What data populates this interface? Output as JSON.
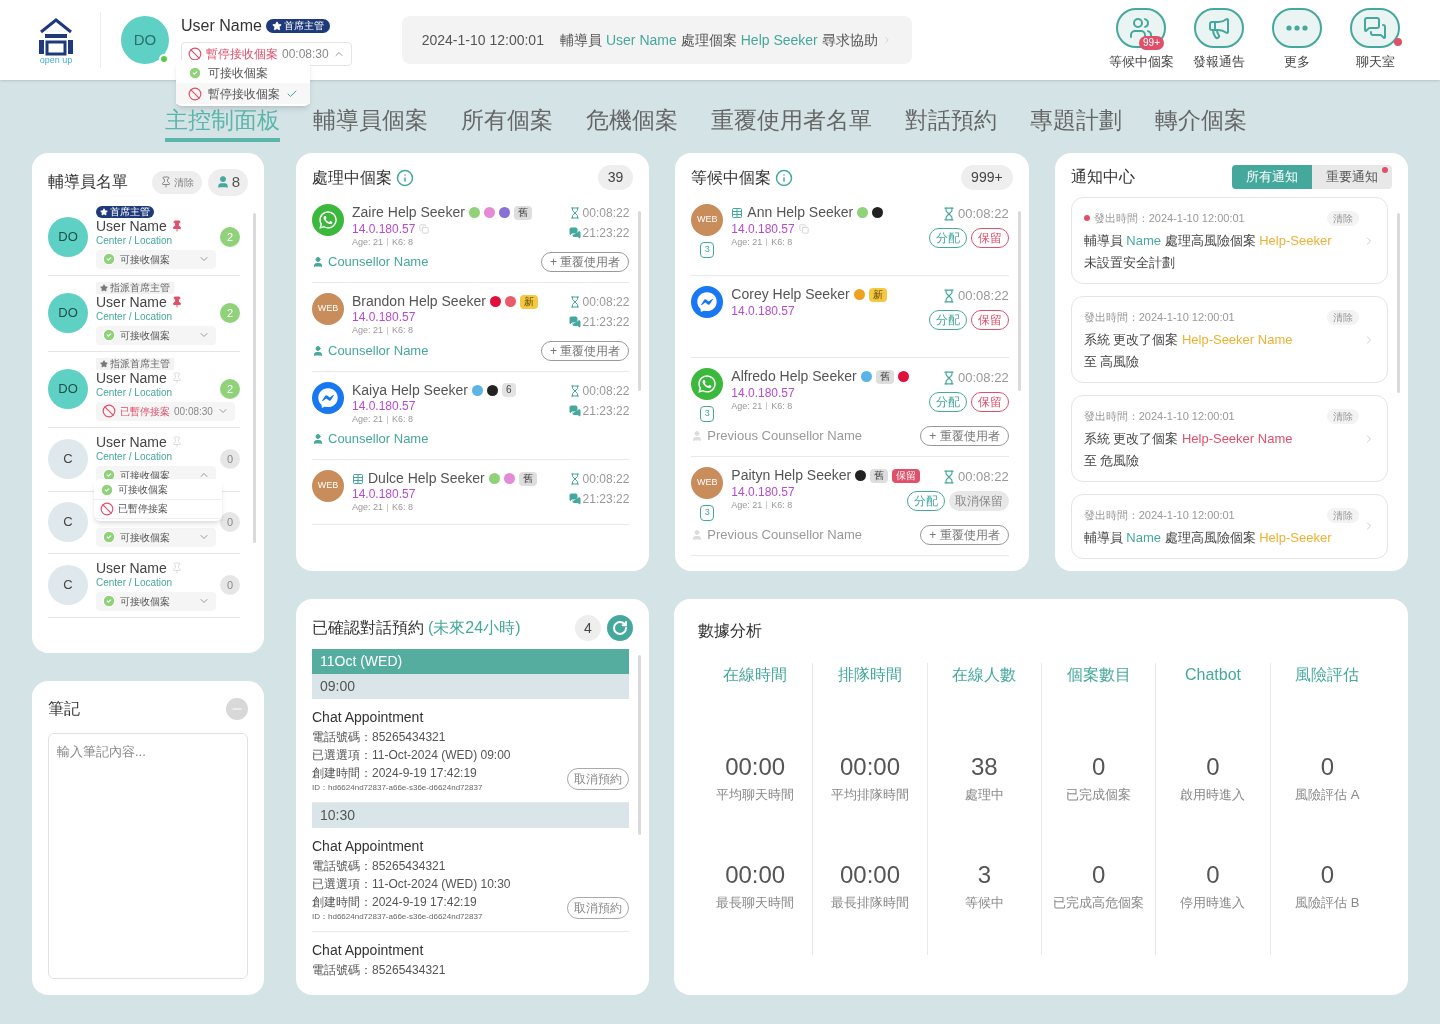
{
  "header": {
    "logo_text": "open up",
    "user": {
      "initials": "DO",
      "online": true,
      "name": "User Name",
      "role": "首席主管",
      "status": {
        "kind": "paused",
        "label": "暫停接收個案",
        "timer": "00:08:30",
        "expanded": true,
        "options": [
          {
            "kind": "available",
            "label": "可接收個案",
            "selected": false
          },
          {
            "kind": "paused",
            "label": "暫停接收個案",
            "selected": true
          }
        ]
      }
    },
    "ticker": {
      "time": "2024-1-10 12:00:01",
      "parts": [
        {
          "kind": "text",
          "text": "輔導員"
        },
        {
          "kind": "link",
          "text": "User Name"
        },
        {
          "kind": "text",
          "text": "處理個案"
        },
        {
          "kind": "link",
          "text": "Help Seeker"
        },
        {
          "kind": "text",
          "text": "尋求協助"
        }
      ]
    },
    "actions": [
      {
        "kind": "waiting",
        "label": "等候中個案",
        "badge": "99+",
        "alert": false
      },
      {
        "kind": "broadcast",
        "label": "發報通告",
        "alert": false
      },
      {
        "kind": "more",
        "label": "更多",
        "alert": false
      },
      {
        "kind": "chat",
        "label": "聊天室",
        "alert": true
      }
    ]
  },
  "tabs": [
    {
      "label": "主控制面板",
      "selected": true
    },
    {
      "label": "輔導員個案",
      "selected": false
    },
    {
      "label": "所有個案",
      "selected": false
    },
    {
      "label": "危機個案",
      "selected": false
    },
    {
      "label": "重覆使用者名單",
      "selected": false
    },
    {
      "label": "對話預約",
      "selected": false
    },
    {
      "label": "專題計劃",
      "selected": false
    },
    {
      "label": "轉介個案",
      "selected": false
    }
  ],
  "counsellors": {
    "title": "輔導員名單",
    "clear": "清除",
    "count": "8",
    "items": [
      {
        "role": {
          "kind": "chief",
          "label": "首席主管"
        },
        "initials": "DO",
        "active": true,
        "name": "User Name",
        "pinned": true,
        "location": "Center / Location",
        "status": {
          "kind": "available",
          "label": "可接收個案",
          "expanded": false
        },
        "cases": "2"
      },
      {
        "role": {
          "kind": "assign",
          "label": "指派首席主管"
        },
        "initials": "DO",
        "active": true,
        "name": "User Name",
        "pinned": true,
        "location": "Center / Location",
        "status": {
          "kind": "available",
          "label": "可接收個案",
          "expanded": false
        },
        "cases": "2"
      },
      {
        "role": {
          "kind": "assign",
          "label": "指派首席主管"
        },
        "initials": "DO",
        "active": true,
        "name": "User Name",
        "pinned": false,
        "location": "Center / Location",
        "status": {
          "kind": "paused",
          "label": "已暫停接案",
          "timer": "00:08:30",
          "expanded": false
        },
        "cases": "2"
      },
      {
        "initials": "C",
        "active": false,
        "name": "User Name",
        "pinned": false,
        "location": "Center / Location",
        "status": {
          "kind": "available",
          "label": "可接收個案",
          "expanded": true,
          "options": [
            {
              "kind": "available",
              "label": "可接收個案"
            },
            {
              "kind": "paused",
              "label": "已暫停接案"
            }
          ]
        },
        "cases": "0"
      },
      {
        "initials": "C",
        "active": false,
        "status": {
          "kind": "available",
          "label": "可接收個案",
          "expanded": false
        },
        "cases": "0"
      },
      {
        "initials": "C",
        "active": false,
        "name": "User Name",
        "pinned": false,
        "location": "Center / Location",
        "status": {
          "kind": "available",
          "label": "可接收個案",
          "expanded": false
        },
        "cases": "0"
      }
    ]
  },
  "notes": {
    "title": "筆記",
    "placeholder": "輸入筆記內容..."
  },
  "processing": {
    "title": "處理中個案",
    "count": "39",
    "items": [
      {
        "channel": {
          "kind": "whatsapp"
        },
        "form": false,
        "name": "Zaire Help Seeker",
        "tags": [
          {
            "kind": "dot",
            "color": "#8fd27a"
          },
          {
            "kind": "dot",
            "color": "#e58ad6"
          },
          {
            "kind": "dot",
            "color": "#8b6fd6"
          },
          {
            "kind": "old",
            "text": "舊"
          }
        ],
        "ip": "14.0.180.57",
        "copyable": true,
        "age": "Age: 21",
        "k6": "K6: 8",
        "wait": "00:08:22",
        "chat": "21:23:22",
        "counsellor": "Counsellor Name",
        "repeat": "+ 重覆使用者"
      },
      {
        "channel": {
          "kind": "web",
          "label": "WEB"
        },
        "form": false,
        "name": "Brandon Help Seeker",
        "tags": [
          {
            "kind": "dot",
            "color": "#e0103a"
          },
          {
            "kind": "dot",
            "color": "#ea5a6a"
          },
          {
            "kind": "new",
            "text": "新"
          }
        ],
        "ip": "14.0.180.57",
        "copyable": false,
        "age": "Age: 21",
        "k6": "K6: 8",
        "wait": "00:08:22",
        "chat": "21:23:22",
        "counsellor": "Counsellor Name",
        "repeat": "+ 重覆使用者"
      },
      {
        "channel": {
          "kind": "messenger"
        },
        "form": false,
        "name": "Kaiya Help Seeker",
        "tags": [
          {
            "kind": "dot",
            "color": "#5ab4e6"
          },
          {
            "kind": "dot",
            "color": "#222222"
          },
          {
            "kind": "count",
            "text": "6"
          }
        ],
        "ip": "14.0.180.57",
        "copyable": false,
        "age": "Age: 21",
        "k6": "K6: 8",
        "wait": "00:08:22",
        "chat": "21:23:22",
        "counsellor": "Counsellor Name"
      },
      {
        "channel": {
          "kind": "web",
          "label": "WEB"
        },
        "form": true,
        "name": "Dulce Help Seeker",
        "tags": [
          {
            "kind": "dot",
            "color": "#8fd27a"
          },
          {
            "kind": "dot",
            "color": "#e58ad6"
          },
          {
            "kind": "old",
            "text": "舊"
          }
        ],
        "ip": "14.0.180.57",
        "copyable": false,
        "age": "Age: 21",
        "k6": "K6: 8",
        "wait": "00:08:22",
        "chat": "21:23:22"
      }
    ]
  },
  "waiting": {
    "title": "等候中個案",
    "count": "999+",
    "items": [
      {
        "channel": {
          "kind": "web",
          "label": "WEB"
        },
        "calendar_day": "3",
        "form": true,
        "name": "Ann Help Seeker",
        "tags": [
          {
            "kind": "dot",
            "color": "#8fd27a"
          },
          {
            "kind": "dot",
            "color": "#222222"
          }
        ],
        "ip": "14.0.180.57",
        "copyable": true,
        "age": "Age: 21",
        "k6": "K6: 8",
        "wait": "00:08:22",
        "actions": [
          {
            "kind": "assign",
            "label": "分配"
          },
          {
            "kind": "hold",
            "label": "保留"
          }
        ]
      },
      {
        "channel": {
          "kind": "messenger"
        },
        "form": false,
        "name": "Corey Help Seeker",
        "tags": [
          {
            "kind": "dot",
            "color": "#f0a020"
          },
          {
            "kind": "new",
            "text": "新"
          }
        ],
        "ip": "14.0.180.57",
        "copyable": false,
        "wait": "00:08:22",
        "actions": [
          {
            "kind": "assign",
            "label": "分配"
          },
          {
            "kind": "hold",
            "label": "保留"
          }
        ]
      },
      {
        "channel": {
          "kind": "whatsapp"
        },
        "calendar_day": "3",
        "form": false,
        "name": "Alfredo Help Seeker",
        "tags": [
          {
            "kind": "dot",
            "color": "#5ab4e6"
          },
          {
            "kind": "old",
            "text": "舊"
          },
          {
            "kind": "dot",
            "color": "#e0103a"
          }
        ],
        "ip": "14.0.180.57",
        "copyable": false,
        "age": "Age: 21",
        "k6": "K6: 8",
        "wait": "00:08:22",
        "actions": [
          {
            "kind": "assign",
            "label": "分配"
          },
          {
            "kind": "hold",
            "label": "保留"
          }
        ],
        "previous": "Previous Counsellor Name",
        "repeat": "+ 重覆使用者"
      },
      {
        "channel": {
          "kind": "web",
          "label": "WEB"
        },
        "calendar_day": "3",
        "form": false,
        "name": "Paityn Help Seeker",
        "tags": [
          {
            "kind": "dot",
            "color": "#222222"
          },
          {
            "kind": "old",
            "text": "舊"
          },
          {
            "kind": "hold",
            "text": "保留"
          }
        ],
        "ip": "14.0.180.57",
        "copyable": false,
        "age": "Age: 21",
        "k6": "K6: 8",
        "wait": "00:08:22",
        "actions": [
          {
            "kind": "assign",
            "label": "分配"
          },
          {
            "kind": "unhold",
            "label": "取消保留"
          }
        ],
        "previous": "Previous Counsellor Name",
        "repeat": "+ 重覆使用者"
      }
    ]
  },
  "notifications": {
    "title": "通知中心",
    "tabs": [
      {
        "label": "所有通知",
        "selected": true,
        "alert": false
      },
      {
        "label": "重要通知",
        "selected": false,
        "alert": true
      }
    ],
    "items": [
      {
        "unread": true,
        "time": "發出時間：2024-1-10 12:00:01",
        "clear": "清除",
        "lines": [
          [
            {
              "kind": "text",
              "text": "輔導員 "
            },
            {
              "kind": "counsellor",
              "text": "Name"
            },
            {
              "kind": "text",
              "text": " 處理高風險個案 "
            },
            {
              "kind": "seeker",
              "text": "Help-Seeker"
            }
          ],
          [
            {
              "kind": "text",
              "text": "未設置安全計劃"
            }
          ]
        ]
      },
      {
        "unread": false,
        "time": "發出時間：2024-1-10 12:00:01",
        "clear": "清除",
        "lines": [
          [
            {
              "kind": "text",
              "text": "系統 更改了個案 "
            },
            {
              "kind": "seeker",
              "text": "Help-Seeker Name"
            }
          ],
          [
            {
              "kind": "text",
              "text": "至 高風險"
            }
          ]
        ]
      },
      {
        "unread": false,
        "time": "發出時間：2024-1-10 12:00:01",
        "clear": "清除",
        "lines": [
          [
            {
              "kind": "text",
              "text": "系統 更改了個案 "
            },
            {
              "kind": "critical",
              "text": "Help-Seeker Name"
            }
          ],
          [
            {
              "kind": "text",
              "text": "至 危風險"
            }
          ]
        ]
      },
      {
        "unread": false,
        "time": "發出時間：2024-1-10 12:00:01",
        "clear": "清除",
        "lines": [
          [
            {
              "kind": "text",
              "text": "輔導員 "
            },
            {
              "kind": "counsellor",
              "text": "Name"
            },
            {
              "kind": "text",
              "text": " 處理高風險個案 "
            },
            {
              "kind": "seeker",
              "text": "Help-Seeker"
            }
          ]
        ]
      }
    ]
  },
  "appointments": {
    "title": "已確認對話預約",
    "subtitle": "(未來24小時)",
    "count": "4",
    "days": [
      {
        "date": "11Oct (WED)",
        "slots": [
          {
            "time": "09:00",
            "items": [
              {
                "title": "Chat Appointment",
                "phone": "電話號碼：85265434321",
                "chosen": "已選選項：11-Oct-2024 (WED) 09:00",
                "created": "創建時間：2024-9-19 17:42:19",
                "id": "ID：hd6624nd72837-a66e-s36e-d6624nd72837",
                "cancel": "取消預約"
              }
            ]
          },
          {
            "time": "10:30",
            "items": [
              {
                "title": "Chat Appointment",
                "phone": "電話號碼：85265434321",
                "chosen": "已選選項：11-Oct-2024 (WED) 10:30",
                "created": "創建時間：2024-9-19 17:42:19",
                "id": "ID：hd6624nd72837-a66e-s36e-d6624nd72837",
                "cancel": "取消預約"
              },
              {
                "title": "Chat Appointment",
                "phone": "電話號碼：85265434321"
              }
            ]
          }
        ]
      }
    ]
  },
  "analytics": {
    "title": "數據分析",
    "columns": [
      {
        "title": "在線時間",
        "rows": [
          {
            "value": "00:00",
            "label": "平均聊天時間"
          },
          {
            "value": "00:00",
            "label": "最長聊天時間"
          }
        ]
      },
      {
        "title": "排隊時間",
        "rows": [
          {
            "value": "00:00",
            "label": "平均排隊時間"
          },
          {
            "value": "00:00",
            "label": "最長排隊時間"
          }
        ]
      },
      {
        "title": "在線人數",
        "rows": [
          {
            "value": "38",
            "label": "處理中"
          },
          {
            "value": "3",
            "label": "等候中"
          }
        ]
      },
      {
        "title": "個案數目",
        "rows": [
          {
            "value": "0",
            "label": "已完成個案"
          },
          {
            "value": "0",
            "label": "已完成高危個案"
          }
        ]
      },
      {
        "title": "Chatbot",
        "rows": [
          {
            "value": "0",
            "label": "啟用時進入"
          },
          {
            "value": "0",
            "label": "停用時進入"
          }
        ]
      },
      {
        "title": "風險評估",
        "rows": [
          {
            "value": "0",
            "label": "風險評估 A"
          },
          {
            "value": "0",
            "label": "風險評估 B"
          }
        ]
      }
    ]
  }
}
